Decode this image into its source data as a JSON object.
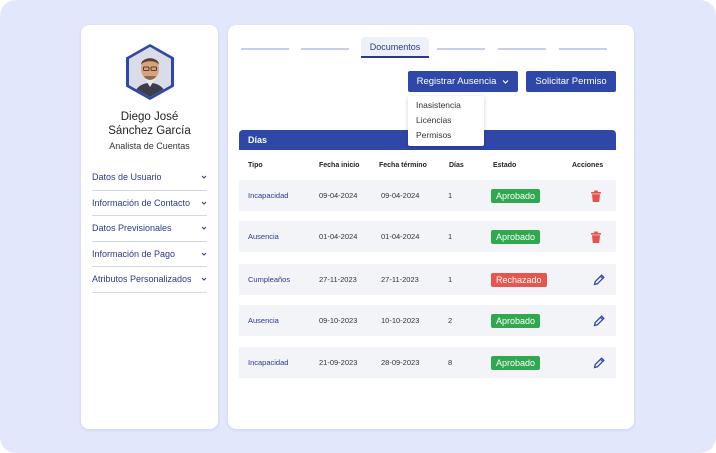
{
  "profile": {
    "name_line1": "Diego José",
    "name_line2": "Sánchez García",
    "role": "Analista de Cuentas"
  },
  "sidebar": {
    "items": [
      {
        "label": "Datos de Usuario"
      },
      {
        "label": "Información de Contacto"
      },
      {
        "label": "Datos Previsionales"
      },
      {
        "label": "Información de Pago"
      },
      {
        "label": "Atributos Personalizados"
      }
    ]
  },
  "tabs": {
    "active_label": "Documentos"
  },
  "toolbar": {
    "register_label": "Registrar Ausencia",
    "request_label": "Solicitar Permiso"
  },
  "dropdown": {
    "items": [
      "Inasistencia",
      "Licencias",
      "Permisos"
    ]
  },
  "table": {
    "title": "Días",
    "columns": [
      "Tipo",
      "Fecha inicio",
      "Fecha término",
      "Días",
      "Estado",
      "Acciones"
    ],
    "rows": [
      {
        "tipo": "Incapacidad",
        "inicio": "09-04-2024",
        "termino": "09-04-2024",
        "dias": "1",
        "estado": "Aprobado",
        "status": "ok",
        "action": "delete"
      },
      {
        "tipo": "Ausencia",
        "inicio": "01-04-2024",
        "termino": "01-04-2024",
        "dias": "1",
        "estado": "Aprobado",
        "status": "ok",
        "action": "delete"
      },
      {
        "tipo": "Cumpleaños",
        "inicio": "27-11-2023",
        "termino": "27-11-2023",
        "dias": "1",
        "estado": "Rechazado",
        "status": "rejected",
        "action": "edit"
      },
      {
        "tipo": "Ausencia",
        "inicio": "09-10-2023",
        "termino": "10-10-2023",
        "dias": "2",
        "estado": "Aprobado",
        "status": "ok",
        "action": "edit"
      },
      {
        "tipo": "Incapacidad",
        "inicio": "21-09-2023",
        "termino": "28-09-2023",
        "dias": "8",
        "estado": "Aprobado",
        "status": "ok",
        "action": "edit"
      }
    ]
  },
  "colors": {
    "primary": "#2f47a6",
    "approved": "#2fa84f",
    "rejected": "#e5564f",
    "delete": "#e5534b",
    "background": "#e3e7fb"
  }
}
